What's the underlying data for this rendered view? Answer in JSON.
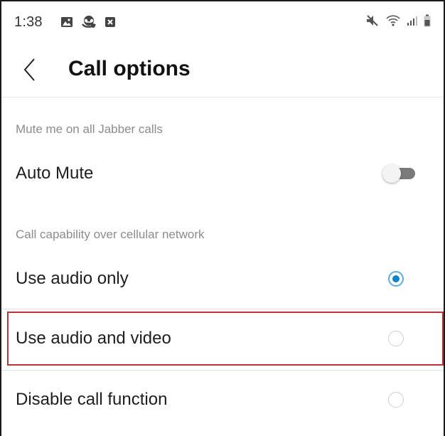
{
  "status_bar": {
    "time": "1:38",
    "left_icons": [
      "image-icon",
      "voicemail-icon",
      "close-box-icon"
    ],
    "right_icons": [
      "mute-icon",
      "wifi-icon",
      "signal-icon",
      "battery-icon"
    ]
  },
  "header": {
    "title": "Call options",
    "back_icon": "chevron-left-icon"
  },
  "sections": {
    "mute": {
      "label": "Mute me on all Jabber calls",
      "auto_mute_label": "Auto Mute",
      "auto_mute_on": false
    },
    "capability": {
      "label": "Call capability over cellular network",
      "options": [
        {
          "label": "Use audio only",
          "selected": true
        },
        {
          "label": "Use audio and video",
          "selected": false
        },
        {
          "label": "Disable call function",
          "selected": false
        }
      ]
    }
  },
  "colors": {
    "accent": "#0b84c9",
    "highlight": "#c0303a",
    "section_label": "#8c8c8c",
    "toggle_off_track": "#7a7a7a"
  }
}
